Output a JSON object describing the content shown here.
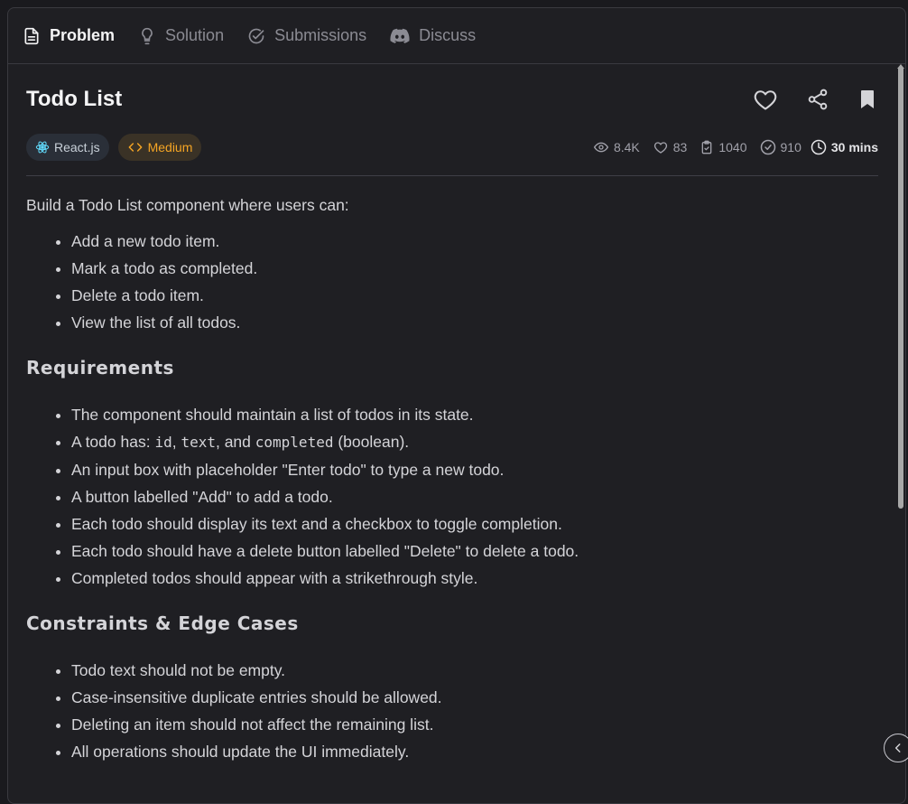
{
  "tabs": [
    {
      "label": "Problem",
      "icon": "document-icon",
      "active": true
    },
    {
      "label": "Solution",
      "icon": "lightbulb-icon"
    },
    {
      "label": "Submissions",
      "icon": "check-circle-icon"
    },
    {
      "label": "Discuss",
      "icon": "discord-icon"
    }
  ],
  "problem": {
    "title": "Todo List",
    "tech_tag": "React.js",
    "difficulty": "Medium",
    "stats": {
      "views": "8.4K",
      "likes": "83",
      "submissions": "1040",
      "solved": "910",
      "time": "30 mins"
    },
    "intro": "Build a Todo List component where users can:",
    "features": [
      "Add a new todo item.",
      "Mark a todo as completed.",
      "Delete a todo item.",
      "View the list of all todos."
    ],
    "requirements_heading": "Requirements",
    "requirements": {
      "r1": "The component should maintain a list of todos in its state.",
      "r2_prefix": "A todo has: ",
      "r2_code1": "id",
      "r2_sep1": ", ",
      "r2_code2": "text",
      "r2_sep2": ", and ",
      "r2_code3": "completed",
      "r2_suffix": " (boolean).",
      "r3": "An input box with placeholder \"Enter todo\" to type a new todo.",
      "r4": "A button labelled \"Add\" to add a todo.",
      "r5": "Each todo should display its text and a checkbox to toggle completion.",
      "r6": "Each todo should have a delete button labelled \"Delete\" to delete a todo.",
      "r7": "Completed todos should appear with a strikethrough style."
    },
    "constraints_heading": "Constraints & Edge Cases",
    "constraints": [
      "Todo text should not be empty.",
      "Case-insensitive duplicate entries should be allowed.",
      "Deleting an item should not affect the remaining list.",
      "All operations should update the UI immediately."
    ]
  },
  "colors": {
    "background": "#1f1f23",
    "difficulty_medium": "#f5a524",
    "text": "#d4d4d8"
  }
}
